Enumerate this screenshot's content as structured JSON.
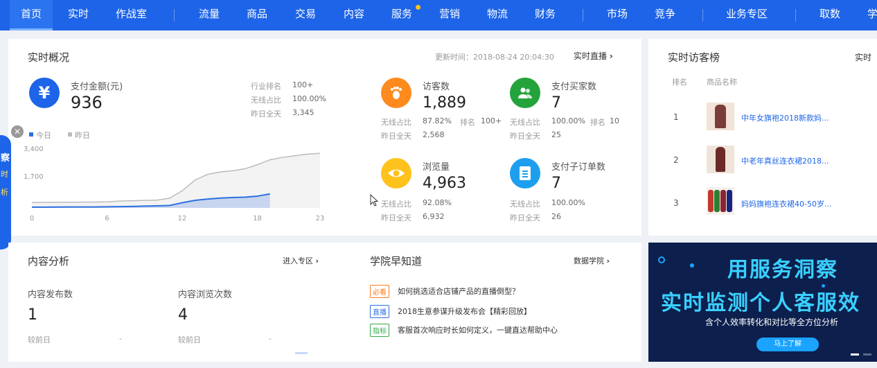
{
  "nav": {
    "items": [
      "首页",
      "实时",
      "作战室",
      "流量",
      "商品",
      "交易",
      "内容",
      "服务",
      "营销",
      "物流",
      "财务",
      "市场",
      "竞争",
      "业务专区",
      "取数",
      "学"
    ]
  },
  "realtime": {
    "title": "实时概况",
    "update_time": "更新时间：2018-08-24 20:04:30",
    "live_link": "实时直播",
    "pay": {
      "label": "支付金额(元)",
      "value": "936",
      "stats": [
        {
          "label": "行业排名",
          "value": "100+"
        },
        {
          "label": "无线占比",
          "value": "100.00%"
        },
        {
          "label": "昨日全天",
          "value": "3,345"
        }
      ]
    },
    "legend": {
      "today": "今日",
      "yesterday": "昨日"
    },
    "metrics": {
      "visitors": {
        "label": "访客数",
        "value": "1,889",
        "wireless_label": "无线占比",
        "wireless": "87.82%",
        "rank_label": "排名",
        "rank": "100+",
        "yesterday_label": "昨日全天",
        "yesterday": "2,568"
      },
      "buyers": {
        "label": "支付买家数",
        "value": "7",
        "wireless_label": "无线占比",
        "wireless": "100.00%",
        "rank_label": "排名",
        "rank": "10",
        "yesterday_label": "昨日全天",
        "yesterday": "25"
      },
      "views": {
        "label": "浏览量",
        "value": "4,963",
        "wireless_label": "无线占比",
        "wireless": "92.08%",
        "yesterday_label": "昨日全天",
        "yesterday": "6,932"
      },
      "orders": {
        "label": "支付子订单数",
        "value": "7",
        "wireless_label": "无线占比",
        "wireless": "100.00%",
        "yesterday_label": "昨日全天",
        "yesterday": "26"
      }
    }
  },
  "chart_data": {
    "type": "area",
    "x": [
      0,
      1,
      2,
      3,
      4,
      5,
      6,
      7,
      8,
      9,
      10,
      11,
      12,
      13,
      14,
      15,
      16,
      17,
      18,
      19,
      20,
      21,
      22,
      23
    ],
    "x_ticks": [
      "0",
      "6",
      "12",
      "18",
      "23"
    ],
    "y_ticks": [
      "3,400",
      "1,700"
    ],
    "ylim": [
      0,
      3400
    ],
    "series": [
      {
        "name": "今日",
        "color": "#2c6fe0",
        "values": [
          50,
          50,
          55,
          60,
          60,
          60,
          70,
          80,
          90,
          110,
          130,
          150,
          320,
          460,
          540,
          600,
          640,
          660,
          720,
          860,
          null,
          null,
          null,
          null
        ]
      },
      {
        "name": "昨日",
        "color": "#bbbbbb",
        "values": [
          330,
          340,
          345,
          350,
          355,
          360,
          370,
          420,
          440,
          460,
          480,
          600,
          1050,
          1700,
          2050,
          2200,
          2280,
          2400,
          2650,
          2950,
          3100,
          3200,
          3300,
          3345
        ]
      }
    ],
    "grid": false,
    "legend": "top-left"
  },
  "visitor_rank": {
    "title": "实时访客榜",
    "header_right": "实时",
    "columns": [
      "排名",
      "商品名称"
    ],
    "rows": [
      {
        "rank": "1",
        "name": "中年女旗袍2018新款妈..."
      },
      {
        "rank": "2",
        "name": "中老年真丝连衣裙2018..."
      },
      {
        "rank": "3",
        "name": "妈妈旗袍连衣裙40-50岁..."
      }
    ]
  },
  "content": {
    "title": "内容分析",
    "enter_link": "进入专区",
    "publish": {
      "label": "内容发布数",
      "value": "1",
      "compare_label": "较前日",
      "compare": "-"
    },
    "browse": {
      "label": "内容浏览次数",
      "value": "4",
      "compare_label": "较前日",
      "compare": "-"
    }
  },
  "academy": {
    "title": "学院早知道",
    "link": "数据学院",
    "items": [
      {
        "tag": "必看",
        "text": "如何挑选适合店铺产品的直播倒型？",
        "color": "#ff7a1a"
      },
      {
        "tag": "直播",
        "text": "2018生意参谋升级发布会【精彩回放】",
        "color": "#2c6fe0"
      },
      {
        "tag": "指标",
        "text": "客服首次响应时长如何定义，一键直达帮助中心",
        "color": "#35a845"
      }
    ]
  },
  "banner": {
    "line1": "用服务洞察",
    "line2": "实时监测个人客服效",
    "line3": "含个人效率转化和对比等全方位分析",
    "button": "马上了解"
  },
  "side_popup": {
    "chars": [
      "察",
      "时",
      "析"
    ]
  }
}
